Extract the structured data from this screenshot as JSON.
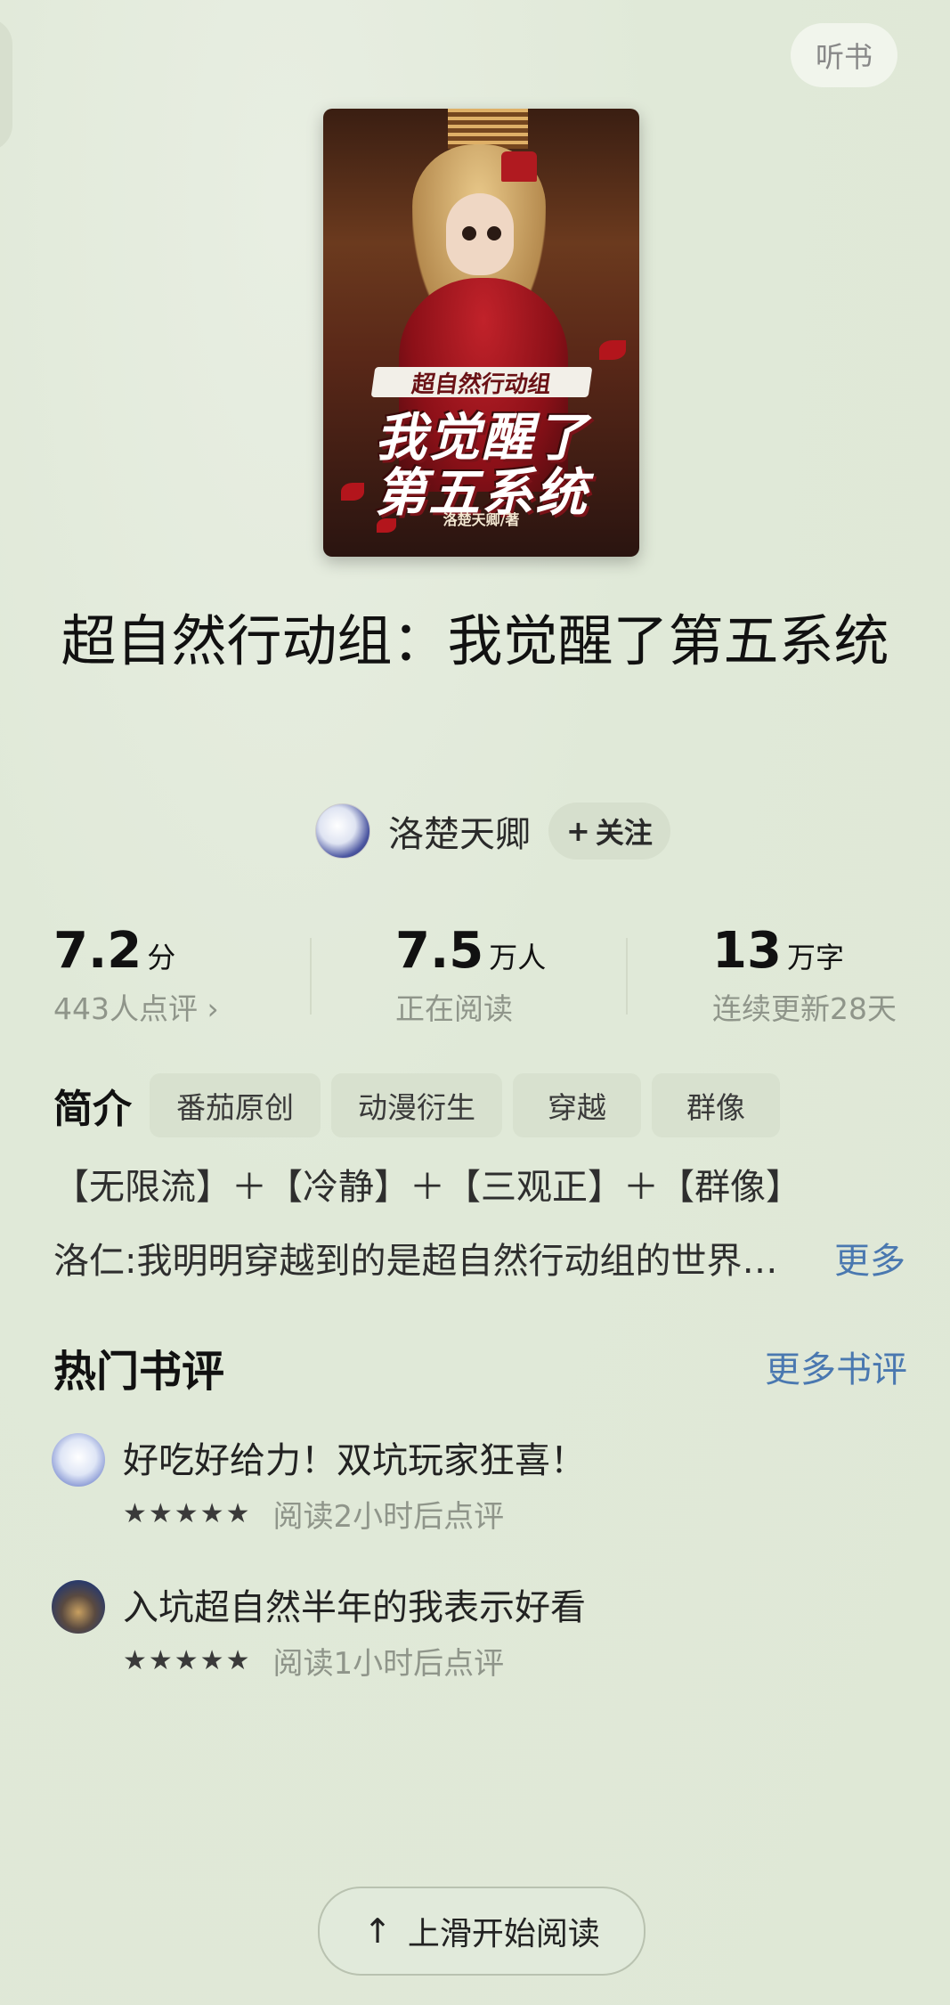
{
  "header": {
    "listen_label": "听书"
  },
  "cover": {
    "series_label": "超自然行动组",
    "title_line1": "我觉醒了",
    "title_line2": "第五系统",
    "author_credit": "洛楚天卿/著"
  },
  "book": {
    "title": "超自然行动组：我觉醒了第五系统",
    "author": "洛楚天卿",
    "follow_label": "关注",
    "follow_icon": "plus-icon"
  },
  "stats": [
    {
      "value": "7.2",
      "unit": "分",
      "sub": "443人点评 ›"
    },
    {
      "value": "7.5",
      "unit": "万人",
      "sub": "正在阅读"
    },
    {
      "value": "13",
      "unit": "万字",
      "sub": "连续更新28天"
    }
  ],
  "intro": {
    "label": "简介",
    "tags": [
      "番茄原创",
      "动漫衍生",
      "穿越",
      "群像"
    ],
    "line1": "【无限流】＋【冷静】＋【三观正】＋【群像】",
    "line2": "洛仁:我明明穿越到的是超自然行动组的世界…",
    "more_label": "更多"
  },
  "reviews": {
    "title": "热门书评",
    "more_label": "更多书评",
    "items": [
      {
        "text": "好吃好给力！双坑玩家狂喜！",
        "stars": "★★★★★",
        "time": "阅读2小时后点评"
      },
      {
        "text": "入坑超自然半年的我表示好看",
        "stars": "★★★★★",
        "time": "阅读1小时后点评"
      }
    ]
  },
  "footer": {
    "start_label": "上滑开始阅读",
    "arrow_icon": "arrow-up-icon"
  }
}
